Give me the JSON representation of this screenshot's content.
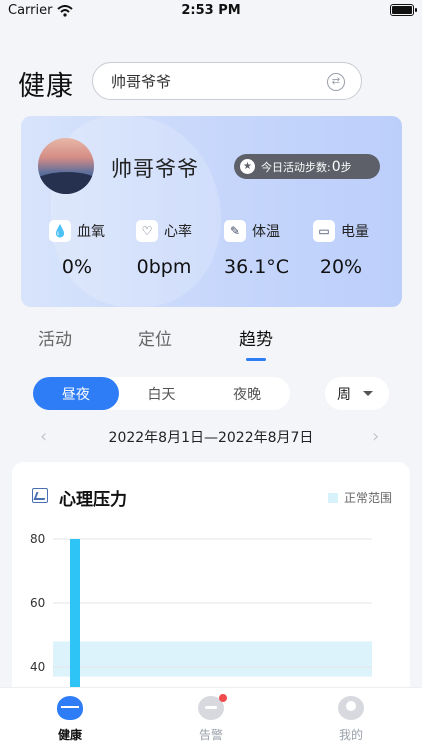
{
  "status_bar": {
    "carrier": "Carrier",
    "time": "2:53 PM"
  },
  "header": {
    "title": "健康",
    "search_value": "帅哥爷爷"
  },
  "profile": {
    "name": "帅哥爷爷",
    "activity_label": "今日活动步数:",
    "activity_steps": "0",
    "activity_unit": "步",
    "metrics": [
      {
        "label": "血氧",
        "value": "0%",
        "icon": "droplet-icon"
      },
      {
        "label": "心率",
        "value": "0bpm",
        "icon": "heart-rate-icon"
      },
      {
        "label": "体温",
        "value": "36.1°C",
        "icon": "thermometer-icon"
      },
      {
        "label": "电量",
        "value": "20%",
        "icon": "battery-icon"
      }
    ]
  },
  "tabs": [
    {
      "label": "活动"
    },
    {
      "label": "定位"
    },
    {
      "label": "趋势",
      "active": true
    }
  ],
  "segment": [
    {
      "label": "昼夜",
      "active": true
    },
    {
      "label": "白天"
    },
    {
      "label": "夜晚"
    }
  ],
  "period": {
    "selected": "周"
  },
  "date_range": "2022年8月1日—2022年8月7日",
  "chart": {
    "title": "心理压力",
    "legend": "正常范围"
  },
  "chart_data": {
    "type": "bar",
    "title": "心理压力",
    "legend": [
      "正常范围"
    ],
    "y_ticks": [
      80,
      60,
      40
    ],
    "bars": [
      {
        "x_index": 0,
        "value": 80
      }
    ],
    "normal_range": [
      37,
      48
    ],
    "ylim": [
      30,
      80
    ],
    "grid": true,
    "colors": {
      "bar": "#2ec4f5",
      "normal_range": "#dcf3fc",
      "grid": "#e3e5e9"
    }
  },
  "tab_bar": [
    {
      "label": "健康",
      "active": true
    },
    {
      "label": "告警",
      "badge": true
    },
    {
      "label": "我的"
    }
  ],
  "colors": {
    "accent": "#2f7df6",
    "badge": "#f24b4b"
  }
}
